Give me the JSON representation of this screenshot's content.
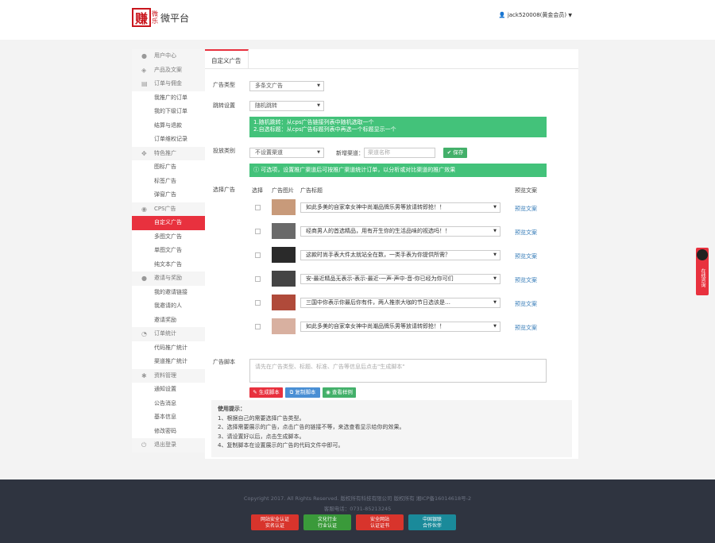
{
  "header": {
    "logo_char": "赚",
    "logo_small_1": "微",
    "logo_small_2": "乐",
    "logo_text": "微平台",
    "user_name": "jack520008(黄金会员)"
  },
  "sidebar": {
    "sections": [
      {
        "title": "用户中心",
        "icon": "user-icon",
        "items": []
      },
      {
        "title": "产品及文案",
        "icon": "cubes-icon",
        "items": []
      },
      {
        "title": "订单与佣金",
        "icon": "list-icon",
        "items": [
          "我推广的订单",
          "我的下级订单",
          "结算与退款",
          "订单维权记录"
        ]
      },
      {
        "title": "特色推广",
        "icon": "arrows-icon",
        "items": [
          "图标广告",
          "标签广告",
          "弹窗广告"
        ]
      },
      {
        "title": "CPS广告",
        "icon": "eye-icon",
        "items": [
          "自定义广告",
          "多图文广告",
          "单图文广告",
          "纯文本广告"
        ]
      },
      {
        "title": "邀请与奖励",
        "icon": "users-icon",
        "items": [
          "我的邀请链接",
          "我邀请的人",
          "邀请奖励"
        ]
      },
      {
        "title": "订单统计",
        "icon": "chart-icon",
        "items": [
          "代码推广统计",
          "渠道推广统计"
        ]
      },
      {
        "title": "资料管理",
        "icon": "cog-icon",
        "items": [
          "通知设置",
          "公告消息",
          "基本信息",
          "修改密码"
        ]
      },
      {
        "title": "退出登录",
        "icon": "power-icon",
        "items": []
      }
    ],
    "active_item": "自定义广告"
  },
  "main": {
    "tab_label": "自定义广告",
    "ad_type_label": "广告类型",
    "ad_type_value": "多条文广告",
    "jump_label": "跳转设置",
    "jump_value": "随机跳转",
    "jump_note_1": "1.随机跳转：从cps广告链接列表中随机选取一个",
    "jump_note_2": "2.自选标题：从cps广告标题列表中再选一个标题显示一个",
    "type_label": "投放类别",
    "type_value": "不设置渠道",
    "channel_label": "新增渠道：",
    "channel_placeholder": "渠道名称",
    "save_button": "保存",
    "info_note": "可选项，设置推广渠道后可按推广渠道统计订单，以分析或对比渠道的推广效果",
    "select_ad_label": "选择广告",
    "col_select": "选择",
    "col_image": "广告图片",
    "col_title": "广告标题",
    "col_preview": "预览文案",
    "rows": [
      {
        "title": "如此多美的自家幸女神中尚潮品牌乐男等放请转即抢！！",
        "preview": "预览文案",
        "thumb": "#c89a7a"
      },
      {
        "title": "经商男人的首选精品，用有开生你的生活品味的视选吗！！",
        "preview": "预览文案",
        "thumb": "#6a6a6a"
      },
      {
        "title": "这款时尚手表大件太就站全在数，一类手表为你提供所需？",
        "preview": "预览文案",
        "thumb": "#2a2a2a"
      },
      {
        "title": "安-最近精品无表示-表示-最近-一声-声中-音-你已经为你可们",
        "preview": "预览文案",
        "thumb": "#444444"
      },
      {
        "title": "三国中你表示你最后你有件，两人推崇大咖的节日选该是…",
        "preview": "预览文案",
        "thumb": "#b04a3a"
      },
      {
        "title": "如此多美的自家幸女神中尚潮品牌乐男等放请转即抢！！",
        "preview": "预览文案",
        "thumb": "#d8b0a0"
      }
    ],
    "script_label": "广告脚本",
    "script_placeholder": "请先在广告类型、标题、标准、广告等信息后点击\"生成脚本\"",
    "gen_button": "生成脚本",
    "copy_button": "复制脚本",
    "preview_button": "查看样例",
    "tips_title": "使用提示：",
    "tips": [
      "1、根据自己的需要选择广告类型。",
      "2、选择需要展示的广告，点击广告的链接不等，来选查看显示给你的效果。",
      "3、请设置好以后，点击生成脚本。",
      "4、复制脚本在设置展示的广告的代码文件中即可。"
    ],
    "tips_red": "生成脚本"
  },
  "footer": {
    "copyright": "Copyright 2017. All Rights Reserved. 版权所有科技有限公司 版权所有 湘ICP备16014618号-2",
    "phone": "客服电话：0731-85213245",
    "badges": [
      {
        "line1": "网站安全认证",
        "line2": "实名认证",
        "color": "#d8342c"
      },
      {
        "line1": "文化行业",
        "line2": "行业认证",
        "color": "#3a9a3a"
      },
      {
        "line1": "安全网站",
        "line2": "认证证书",
        "color": "#d8342c"
      },
      {
        "line1": "中国银联",
        "line2": "合作伙伴",
        "color": "#1a8a9a"
      }
    ]
  },
  "qq_float": "在线咨询"
}
